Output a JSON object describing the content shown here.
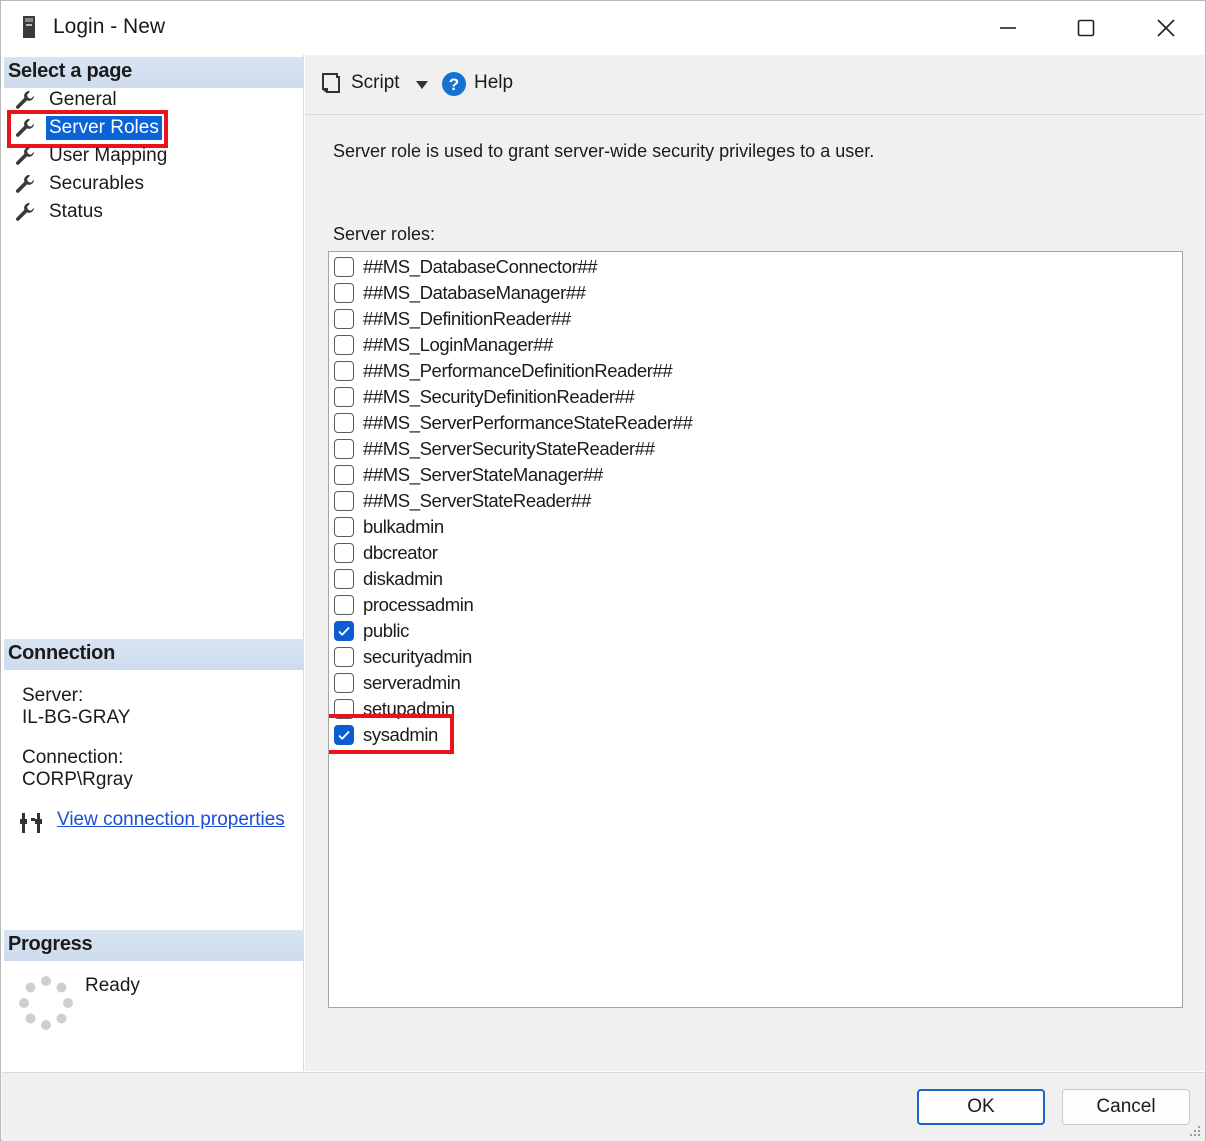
{
  "window": {
    "title": "Login - New"
  },
  "left": {
    "select_page_header": "Select a page",
    "pages": [
      {
        "label": "General",
        "selected": false
      },
      {
        "label": "Server Roles",
        "selected": true
      },
      {
        "label": "User Mapping",
        "selected": false
      },
      {
        "label": "Securables",
        "selected": false
      },
      {
        "label": "Status",
        "selected": false
      }
    ],
    "connection_header": "Connection",
    "server_label": "Server:",
    "server_value": "IL-BG-GRAY",
    "connection_label": "Connection:",
    "connection_value": "CORP\\Rgray",
    "view_connection_link": "View connection properties",
    "progress_header": "Progress",
    "progress_status": "Ready"
  },
  "toolbar": {
    "script_label": "Script",
    "help_label": "Help"
  },
  "main": {
    "description": "Server role is used to grant server-wide security privileges to a user.",
    "roles_label": "Server roles:",
    "roles": [
      {
        "name": "##MS_DatabaseConnector##",
        "checked": false
      },
      {
        "name": "##MS_DatabaseManager##",
        "checked": false
      },
      {
        "name": "##MS_DefinitionReader##",
        "checked": false
      },
      {
        "name": "##MS_LoginManager##",
        "checked": false
      },
      {
        "name": "##MS_PerformanceDefinitionReader##",
        "checked": false
      },
      {
        "name": "##MS_SecurityDefinitionReader##",
        "checked": false
      },
      {
        "name": "##MS_ServerPerformanceStateReader##",
        "checked": false
      },
      {
        "name": "##MS_ServerSecurityStateReader##",
        "checked": false
      },
      {
        "name": "##MS_ServerStateManager##",
        "checked": false
      },
      {
        "name": "##MS_ServerStateReader##",
        "checked": false
      },
      {
        "name": "bulkadmin",
        "checked": false
      },
      {
        "name": "dbcreator",
        "checked": false
      },
      {
        "name": "diskadmin",
        "checked": false
      },
      {
        "name": "processadmin",
        "checked": false
      },
      {
        "name": "public",
        "checked": true
      },
      {
        "name": "securityadmin",
        "checked": false
      },
      {
        "name": "serveradmin",
        "checked": false
      },
      {
        "name": "setupadmin",
        "checked": false
      },
      {
        "name": "sysadmin",
        "checked": true
      }
    ]
  },
  "footer": {
    "ok_label": "OK",
    "cancel_label": "Cancel"
  },
  "colors": {
    "accent": "#0b5cd0",
    "highlight": "#e8131b",
    "link": "#1a4fd8"
  },
  "icons": [
    "app-icon",
    "minimize-icon",
    "maximize-icon",
    "close-icon",
    "wrench-icon",
    "script-icon",
    "dropdown-arrow-icon",
    "help-icon",
    "connection-icon",
    "spinner-icon",
    "checkmark-icon",
    "resize-grip-icon"
  ]
}
